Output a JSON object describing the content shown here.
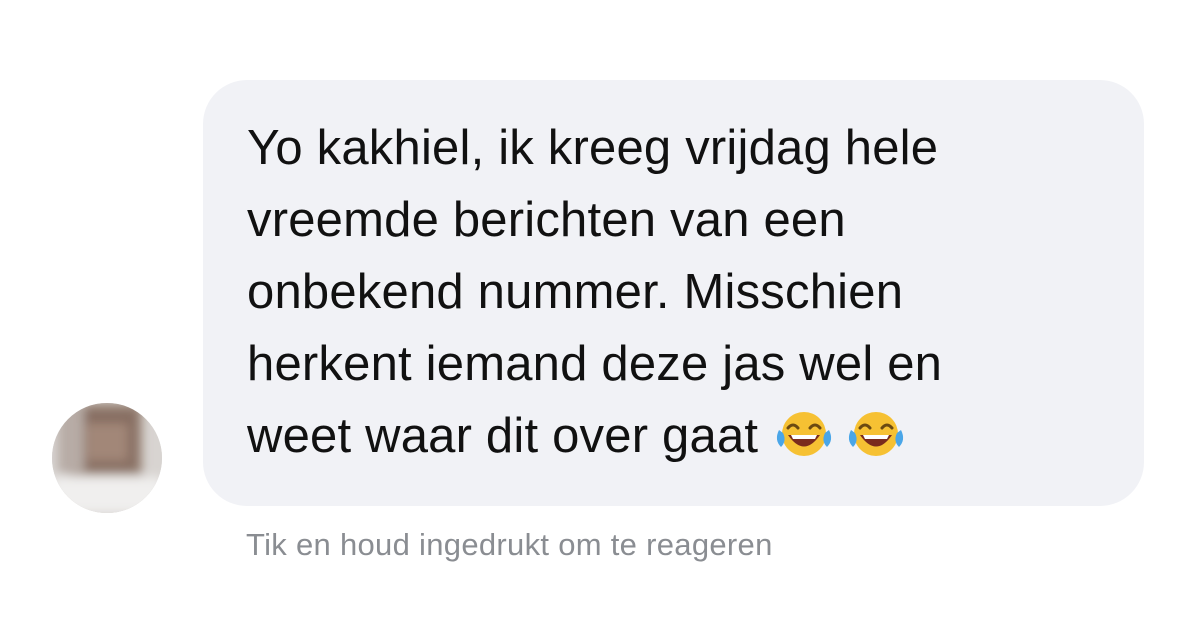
{
  "message": {
    "text": "Yo kakhiel, ik kreeg vrijdag hele\nvreemde berichten van een\nonbekend nummer. Misschien\nherkent iemand deze jas wel en\nweet waar dit over gaat",
    "emojis": [
      "face-with-tears-of-joy-icon",
      "face-with-tears-of-joy-icon"
    ]
  },
  "hint": {
    "text": "Tik en houd ingedrukt om te reageren"
  },
  "colors": {
    "bubble_background": "#f1f2f6",
    "message_text": "#111111",
    "hint_text": "#8a8d92",
    "emoji_face": "#f6c133",
    "emoji_tears": "#4aa6e8"
  }
}
